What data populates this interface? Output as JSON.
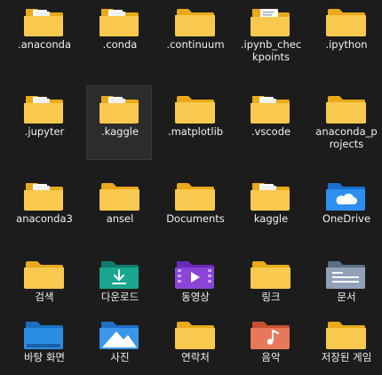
{
  "explorer": {
    "items": [
      {
        "label": ".anaconda",
        "icon": "folder-with-files-icon"
      },
      {
        "label": ".conda",
        "icon": "folder-with-files-icon"
      },
      {
        "label": ".continuum",
        "icon": "folder-icon"
      },
      {
        "label": ".ipynb_checkpoints",
        "icon": "folder-with-document-icon"
      },
      {
        "label": ".ipython",
        "icon": "folder-icon"
      },
      {
        "label": ".jupyter",
        "icon": "folder-with-files-icon"
      },
      {
        "label": ".kaggle",
        "icon": "folder-with-files-icon",
        "selected": true
      },
      {
        "label": ".matplotlib",
        "icon": "folder-icon"
      },
      {
        "label": ".vscode",
        "icon": "folder-with-files-icon"
      },
      {
        "label": "anaconda_projects",
        "icon": "folder-icon"
      },
      {
        "label": "anaconda3",
        "icon": "folder-with-files-icon"
      },
      {
        "label": "ansel",
        "icon": "folder-icon"
      },
      {
        "label": "Documents",
        "icon": "folder-icon"
      },
      {
        "label": "kaggle",
        "icon": "folder-with-files-icon"
      },
      {
        "label": "OneDrive",
        "icon": "onedrive-folder-icon"
      },
      {
        "label": "검색",
        "icon": "folder-icon"
      },
      {
        "label": "다운로드",
        "icon": "downloads-folder-icon"
      },
      {
        "label": "동영상",
        "icon": "videos-folder-icon"
      },
      {
        "label": "링크",
        "icon": "folder-icon"
      },
      {
        "label": "문서",
        "icon": "documents-folder-icon"
      },
      {
        "label": "바탕 화면",
        "icon": "desktop-folder-icon"
      },
      {
        "label": "사진",
        "icon": "pictures-folder-icon"
      },
      {
        "label": "연락처",
        "icon": "folder-icon"
      },
      {
        "label": "음악",
        "icon": "music-folder-icon"
      },
      {
        "label": "저장된 게임",
        "icon": "folder-icon"
      }
    ]
  },
  "colors": {
    "background": "#1c1c1c",
    "folder_back": "#e8a91a",
    "folder_front": "#f8c94e",
    "text": "#f2f2f2"
  }
}
